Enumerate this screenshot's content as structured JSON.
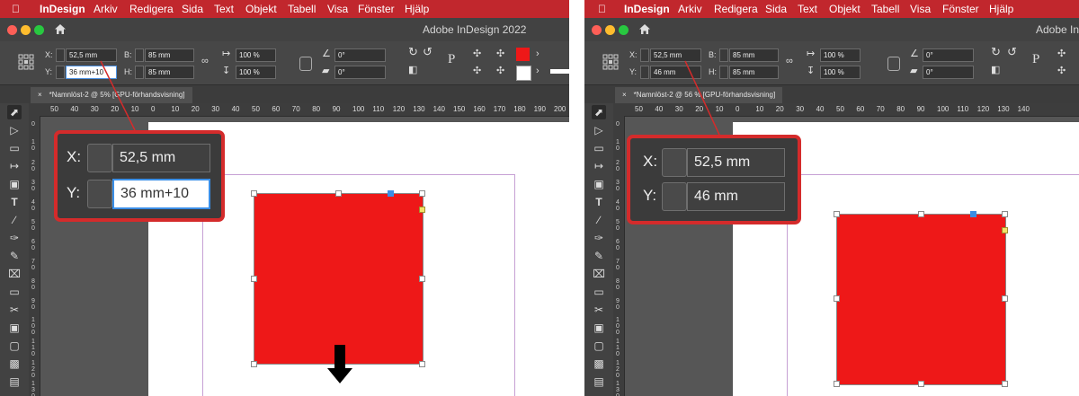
{
  "menu": {
    "app": "InDesign",
    "items": [
      "Arkiv",
      "Redigera",
      "Sida",
      "Text",
      "Objekt",
      "Tabell",
      "Visa",
      "Fönster",
      "Hjälp"
    ]
  },
  "window_title": "Adobe InDesign 2022",
  "window_title_right": "Adobe InD",
  "document_tab": "*Namnlöst-2 @ 56 % [GPU-förhandsvisning]",
  "document_tab_left": "*Namnlöst-2 @ 5",
  "document_tab_left_end": "% [GPU-förhandsvisning]",
  "control": {
    "x_label": "X:",
    "y_label": "Y:",
    "w_label": "B:",
    "h_label": "H:",
    "x_value": "52,5 mm",
    "w_value": "85 mm",
    "h_value": "85 mm",
    "scale_x": "100 %",
    "scale_y": "100 %",
    "rotate": "0°",
    "shear": "0°"
  },
  "before": {
    "y_value": "36 mm+10"
  },
  "after": {
    "y_value": "46 mm"
  },
  "ruler": {
    "left": [
      "50",
      "40",
      "30",
      "20",
      "10",
      "0",
      "10",
      "20",
      "30",
      "40",
      "50",
      "60",
      "70",
      "80",
      "90",
      "100",
      "110",
      "120",
      "130",
      "140",
      "150",
      "160",
      "170",
      "180",
      "190",
      "200"
    ],
    "right": [
      "50",
      "40",
      "30",
      "20",
      "10",
      "0",
      "10",
      "20",
      "30",
      "40",
      "50",
      "60",
      "70",
      "80",
      "90",
      "100",
      "110",
      "120",
      "130",
      "140"
    ]
  },
  "vruler": [
    "0",
    "1 0",
    "2 0",
    "3 0",
    "4 0",
    "5 0",
    "6 0",
    "7 0",
    "8 0",
    "9 0",
    "1 0 0",
    "1 1 0",
    "1 2 0",
    "1 3 0"
  ],
  "colors": {
    "menubar": "#c1272d",
    "fill": "#ee1818",
    "highlight": "#d42b2b"
  },
  "icons": [
    "apple-icon",
    "home-icon",
    "reference-point-icon",
    "constrain-link-icon",
    "selection-tool-icon",
    "arrow-down-icon"
  ]
}
